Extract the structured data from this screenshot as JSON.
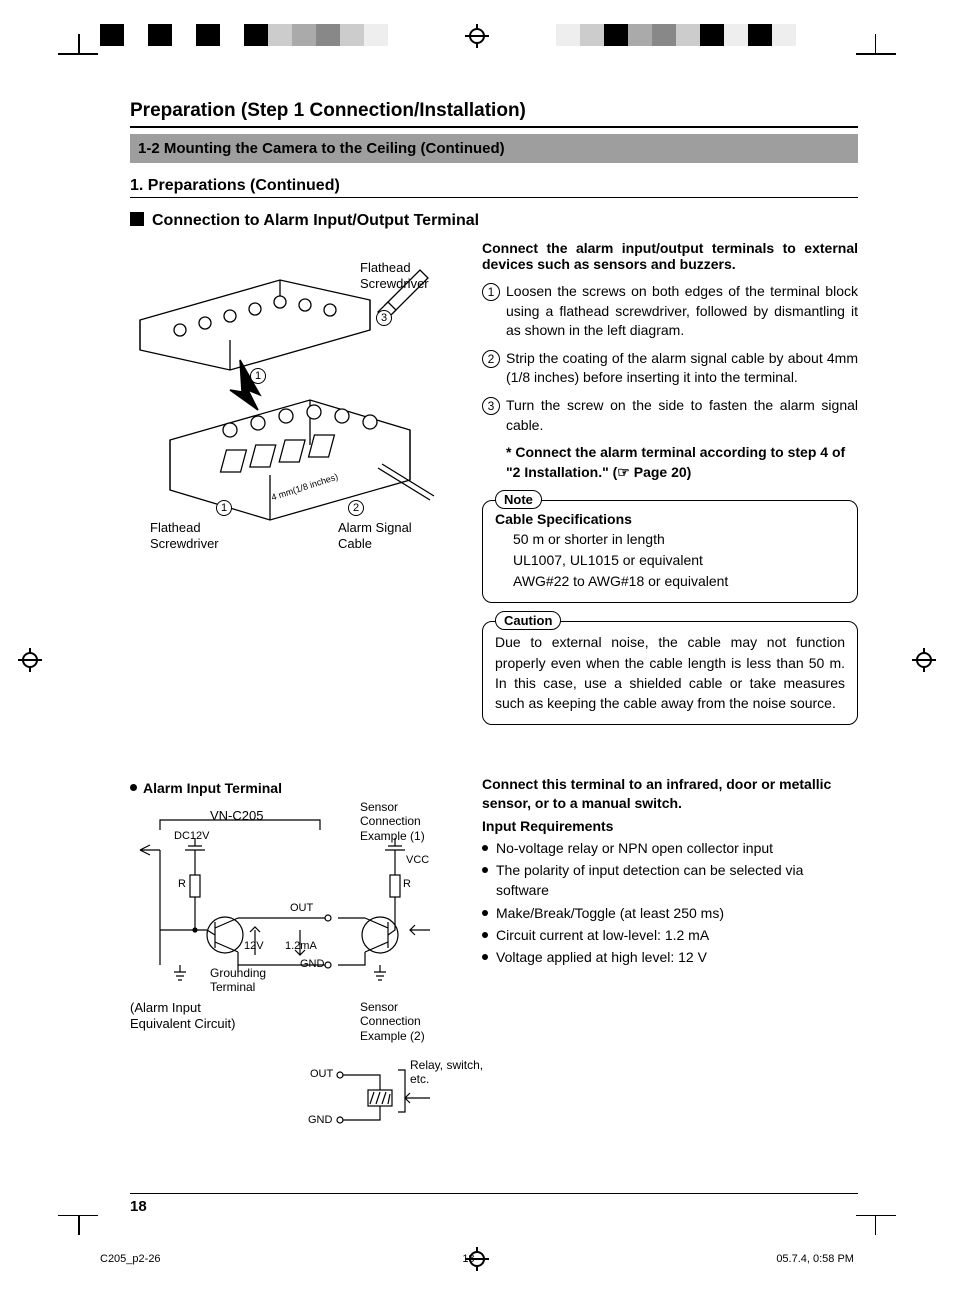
{
  "section_title": "Preparation (Step 1 Connection/Installation)",
  "gray_band": "1-2 Mounting the Camera to the Ceiling (Continued)",
  "sub1": "1.  Preparations (Continued)",
  "sub2": "Connection to Alarm Input/Output Terminal",
  "fig1": {
    "label_flathead_top": "Flathead\nScrewdriver",
    "num3": "3",
    "num1a": "1",
    "num1b": "1",
    "num2": "2",
    "label_flathead_bottom": "Flathead\nScrewdriver",
    "label_alarm_cable": "Alarm Signal\nCable",
    "dim": "4 mm(1/8 inches)"
  },
  "right": {
    "intro": "Connect the alarm input/output terminals to external devices such as sensors and buzzers.",
    "steps": [
      "Loosen the screws on both edges of the terminal block using a flathead screwdriver, followed by dismantling it as shown in the left diagram.",
      "Strip the coating of the alarm signal cable by about 4mm (1/8 inches) before inserting it into the terminal.",
      "Turn the screw on the side to fasten the alarm signal cable."
    ],
    "step_nums": [
      "1",
      "2",
      "3"
    ],
    "asterisk": "* Connect the alarm terminal according to step 4 of \"2 Installation.\" (☞ Page 20)",
    "note_label": "Note",
    "note_title": "Cable Specifications",
    "note_lines": [
      "50 m or shorter in length",
      "UL1007, UL1015 or equivalent",
      "AWG#22 to AWG#18 or equivalent"
    ],
    "caution_label": "Caution",
    "caution_text": "Due to external noise, the cable may not function properly even when the cable length is less than 50 m. In this case, use a shielded cable or take measures such as keeping the cable away from the noise source."
  },
  "alarm_input_heading": "Alarm Input Terminal",
  "fig2": {
    "vn": "VN-C205",
    "dc12v": "DC12V",
    "r1": "R",
    "r2": "R",
    "out1": "OUT",
    "v12": "12V",
    "ma": "1.2mA",
    "grounding": "Grounding\nTerminal",
    "gnd1": "GND",
    "equiv": "(Alarm Input\nEquivalent Circuit)",
    "sensor1": "Sensor\nConnection\nExample (1)",
    "vcc": "VCC",
    "sensor2": "Sensor\nConnection\nExample (2)",
    "relay": "Relay, switch,\netc.",
    "out2": "OUT",
    "gnd2": "GND"
  },
  "sec2": {
    "hdr": "Connect this terminal to an infrared, door or metallic sensor, or to a manual switch.",
    "sub": "Input Requirements",
    "bullets": [
      "No-voltage relay or NPN open collector input",
      "The polarity of input detection can be selected via software",
      "Make/Break/Toggle (at least 250 ms)",
      "Circuit current at low-level: 1.2 mA",
      "Voltage applied at high level: 12 V"
    ]
  },
  "page_num": "18",
  "footer": {
    "left": "C205_p2-26",
    "center": "18",
    "right": "05.7.4, 0:58 PM"
  }
}
